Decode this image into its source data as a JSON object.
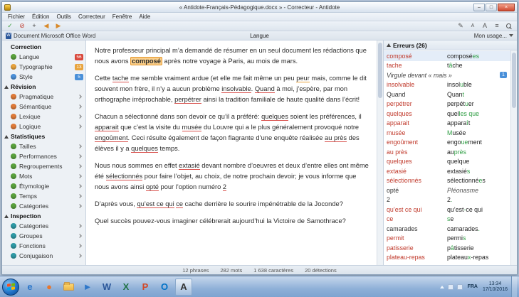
{
  "window": {
    "title": "« Antidote-Français-Pédagogique.docx » - Correcteur - Antidote",
    "menus": [
      "Fichier",
      "Édition",
      "Outils",
      "Correcteur",
      "Fenêtre",
      "Aide"
    ],
    "controls": {
      "min": "–",
      "max": "□",
      "close": "×"
    }
  },
  "toolbar": {
    "left": [
      {
        "name": "approve-icon",
        "glyph": "✓",
        "color": "#3f9b3f"
      },
      {
        "name": "ignore-icon",
        "glyph": "⊘",
        "color": "#c0392b"
      },
      {
        "name": "add-to-dictionary-icon",
        "glyph": "+",
        "color": "#444"
      },
      {
        "name": "previous-detection-icon",
        "glyph": "◀",
        "color": "#d98a2b"
      },
      {
        "name": "next-detection-icon",
        "glyph": "▶",
        "color": "#d98a2b"
      }
    ],
    "right": [
      {
        "name": "edit-icon",
        "glyph": "✎",
        "color": "#555"
      },
      {
        "name": "font-decrease-icon",
        "glyph": "A",
        "color": "#555",
        "small": true
      },
      {
        "name": "font-increase-icon",
        "glyph": "A",
        "color": "#555"
      },
      {
        "name": "settings-icon",
        "glyph": "≡",
        "color": "#555"
      },
      {
        "name": "search-icon"
      }
    ]
  },
  "docbar": {
    "source": "Document Microsoft Office Word",
    "view": "Langue",
    "usage": "Mon usage..."
  },
  "sidebar": {
    "sections": [
      {
        "title": "Correction",
        "triangle": false,
        "items": [
          {
            "label": "Langue",
            "icon": "#5aa23c",
            "badge": "56",
            "badge_color": "#d9473b"
          },
          {
            "label": "Typographie",
            "icon": "#e8a33d",
            "badge": "13",
            "badge_color": "#e8a33d"
          },
          {
            "label": "Style",
            "icon": "#4a90d9",
            "badge": "5",
            "badge_color": "#4a90d9"
          }
        ]
      },
      {
        "title": "Révision",
        "triangle": true,
        "items": [
          {
            "label": "Pragmatique",
            "icon": "#e07b39",
            "chevron": true
          },
          {
            "label": "Sémantique",
            "icon": "#e07b39",
            "chevron": true
          },
          {
            "label": "Lexique",
            "icon": "#e07b39",
            "chevron": true
          },
          {
            "label": "Logique",
            "icon": "#e07b39",
            "chevron": true
          }
        ]
      },
      {
        "title": "Statistiques",
        "triangle": true,
        "items": [
          {
            "label": "Tailles",
            "icon": "#5aa23c",
            "chevron": true
          },
          {
            "label": "Performances",
            "icon": "#5aa23c",
            "chevron": true
          },
          {
            "label": "Regroupements",
            "icon": "#5aa23c",
            "chevron": true
          },
          {
            "label": "Mots",
            "icon": "#5aa23c",
            "chevron": true
          },
          {
            "label": "Étymologie",
            "icon": "#5aa23c",
            "chevron": true
          },
          {
            "label": "Temps",
            "icon": "#5aa23c",
            "chevron": true
          },
          {
            "label": "Catégories",
            "icon": "#5aa23c",
            "chevron": true
          }
        ]
      },
      {
        "title": "Inspection",
        "triangle": true,
        "items": [
          {
            "label": "Catégories",
            "icon": "#2e9aa6",
            "chevron": true
          },
          {
            "label": "Groupes",
            "icon": "#2e9aa6",
            "chevron": true
          },
          {
            "label": "Fonctions",
            "icon": "#2e9aa6",
            "chevron": true
          },
          {
            "label": "Conjugaison",
            "icon": "#2e9aa6",
            "chevron": true
          }
        ]
      }
    ]
  },
  "document": {
    "paragraphs": [
      {
        "segments": [
          {
            "t": "Notre professeur principal m’a demandé de résumer en un seul document les rédactions que nous avons "
          },
          {
            "t": "composé",
            "err": true,
            "selected": true
          },
          {
            "t": " après notre voyage à Paris, au mois de mars."
          }
        ]
      },
      {
        "segments": [
          {
            "t": "Cette "
          },
          {
            "t": "tache",
            "err": true
          },
          {
            "t": " me semble vraiment ardue (et elle me fait même un peu "
          },
          {
            "t": "peur",
            "err": true,
            "warn": true
          },
          {
            "t": " mais, comme le dit souvent mon frère, il n’y a aucun problème "
          },
          {
            "t": "insolvable",
            "err": true
          },
          {
            "t": ". "
          },
          {
            "t": "Quand",
            "err": true
          },
          {
            "t": " à moi,  j’espère, par mon orthographe irréprochable, "
          },
          {
            "t": "perpétrer",
            "err": true
          },
          {
            "t": " ainsi la tradition familiale de haute qualité dans l’écrit!"
          }
        ]
      },
      {
        "segments": [
          {
            "t": "Chacun a sélectionné dans son devoir  ce qu’il a préféré: "
          },
          {
            "t": "quelques",
            "err": true
          },
          {
            "t": " soient les préférences, il "
          },
          {
            "t": "apparait",
            "err": true
          },
          {
            "t": " que c’est la visite du "
          },
          {
            "t": "musée",
            "err": true
          },
          {
            "t": " du Louvre qui a le plus généralement provoqué notre "
          },
          {
            "t": "engoûment",
            "err": true
          },
          {
            "t": ". Ceci résulte également de façon flagrante d’une enquête  réalisée "
          },
          {
            "t": "au près",
            "err": true
          },
          {
            "t": " des élèves il y a "
          },
          {
            "t": "quelques",
            "err": true
          },
          {
            "t": " temps."
          }
        ]
      },
      {
        "segments": [
          {
            "t": "Nous nous sommes en effet "
          },
          {
            "t": "extasié",
            "err": true
          },
          {
            "t": " devant nombre d’oeuvres et deux d’entre elles ont même été "
          },
          {
            "t": "sélectionnés",
            "err": true
          },
          {
            "t": " pour faire l’objet, au choix, de notre prochain devoir; je vous informe que nous avons ainsi "
          },
          {
            "t": "opté",
            "err": true
          },
          {
            "t": " pour l’option numéro "
          },
          {
            "t": "2",
            "err": true
          }
        ]
      },
      {
        "segments": [
          {
            "t": "D’après vous, "
          },
          {
            "t": "qu’est ce qui",
            "err": true
          },
          {
            "t": " "
          },
          {
            "t": "ce",
            "err": true
          },
          {
            "t": " cache derrière le sourire impénétrable de la Joconde?"
          }
        ]
      },
      {
        "segments": [
          {
            "t": "Quel succès pouvez-vous imaginer célébrerait aujourd’hui la Victoire de Samothrace?"
          }
        ]
      }
    ]
  },
  "errors_panel": {
    "title": "Erreurs (26)",
    "rows": [
      {
        "wrong": "composé",
        "fix": [
          [
            "composé",
            0
          ],
          [
            "es",
            1
          ]
        ],
        "selected": true
      },
      {
        "wrong": "tache",
        "fix": [
          [
            "t",
            0
          ],
          [
            "â",
            1
          ],
          [
            "che",
            0
          ]
        ]
      },
      {
        "rule": "Virgule devant « mais »",
        "badge": "1"
      },
      {
        "wrong": "insolvable",
        "fix": [
          [
            "insol",
            0
          ],
          [
            "u",
            1
          ],
          [
            "ble",
            0
          ]
        ]
      },
      {
        "wrong": "Quand",
        "muted": true,
        "fix": [
          [
            "Quan",
            0
          ],
          [
            "t",
            1
          ]
        ]
      },
      {
        "wrong": "perpétrer",
        "fix": [
          [
            "perpét",
            0
          ],
          [
            "u",
            1
          ],
          [
            "er",
            0
          ]
        ]
      },
      {
        "wrong": "quelques",
        "fix": [
          [
            "quel",
            0
          ],
          [
            "les que",
            1
          ]
        ]
      },
      {
        "wrong": "apparait",
        "fix": [
          [
            "appara",
            0
          ],
          [
            "î",
            1
          ],
          [
            "t",
            0
          ]
        ]
      },
      {
        "wrong": "musée",
        "fix": [
          [
            "M",
            1
          ],
          [
            "usée",
            0
          ]
        ]
      },
      {
        "wrong": "engoûment",
        "fix": [
          [
            "engo",
            0
          ],
          [
            "ue",
            1
          ],
          [
            "ment",
            0
          ]
        ]
      },
      {
        "wrong": "au près",
        "fix": [
          [
            "au",
            0
          ],
          [
            "près",
            1
          ]
        ]
      },
      {
        "wrong": "quelques",
        "fix": [
          [
            "quelque",
            0
          ]
        ]
      },
      {
        "wrong": "extasié",
        "fix": [
          [
            "extasié",
            0
          ],
          [
            "s",
            1
          ]
        ]
      },
      {
        "wrong": "sélectionnés",
        "fix": [
          [
            "sélectionné",
            0
          ],
          [
            "e",
            1
          ],
          [
            "s",
            0
          ]
        ]
      },
      {
        "wrong": "opté",
        "muted": true,
        "fix_italic": true,
        "fix": [
          [
            "Pléonasme",
            0
          ]
        ]
      },
      {
        "wrong": "2",
        "muted": true,
        "fix": [
          [
            "2",
            0
          ],
          [
            ".",
            1
          ]
        ]
      },
      {
        "wrong": "qu’est ce qui",
        "fix": [
          [
            "qu’est",
            0
          ],
          [
            "-",
            1
          ],
          [
            "ce qui",
            0
          ]
        ]
      },
      {
        "wrong": "ce",
        "fix": [
          [
            "s",
            1
          ],
          [
            "e",
            0
          ]
        ]
      },
      {
        "wrong": "camarades",
        "muted": true,
        "fix": [
          [
            "camarades",
            0
          ],
          [
            ".",
            1
          ]
        ]
      },
      {
        "wrong": "permit",
        "fix": [
          [
            "permi",
            0
          ],
          [
            "s",
            1
          ]
        ]
      },
      {
        "wrong": "patisserie",
        "fix": [
          [
            "p",
            0
          ],
          [
            "â",
            1
          ],
          [
            "tisserie",
            0
          ]
        ]
      },
      {
        "wrong": "plateau-repas",
        "fix": [
          [
            "plateau",
            0
          ],
          [
            "x",
            1
          ],
          [
            "-repas",
            0
          ]
        ]
      }
    ]
  },
  "statusbar": {
    "stats": [
      "12 phrases",
      "282 mots",
      "1 638 caractères",
      "20 détections"
    ]
  },
  "taskbar": {
    "icons": [
      {
        "name": "internet-explorer",
        "letter": "e",
        "color": "#2e77c9"
      },
      {
        "name": "firefox",
        "letter": "●",
        "color": "#e8762d"
      },
      {
        "name": "explorer",
        "folder": true
      },
      {
        "name": "media-player",
        "letter": "►",
        "color": "#2e77c9"
      },
      {
        "name": "word",
        "letter": "W",
        "color": "#2b579a"
      },
      {
        "name": "excel",
        "letter": "X",
        "color": "#217346"
      },
      {
        "name": "powerpoint",
        "letter": "P",
        "color": "#d24726"
      },
      {
        "name": "outlook",
        "letter": "O",
        "color": "#0072c6"
      },
      {
        "name": "antidote",
        "letter": "A",
        "color": "#333333",
        "active": true
      }
    ],
    "tray": {
      "lang": "FRA",
      "time": "13:34",
      "date": "17/10/2016"
    }
  }
}
